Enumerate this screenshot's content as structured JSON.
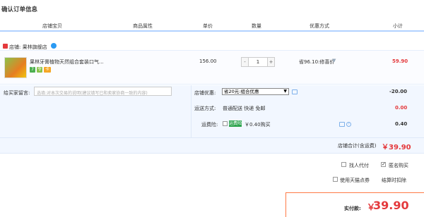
{
  "page_title": "确认订单信息",
  "table_headers": [
    "店铺宝贝",
    "商品属性",
    "单价",
    "数量",
    "优惠方式",
    "小计"
  ],
  "shop": {
    "label": "店铺: 果林旗舰店"
  },
  "item": {
    "title": "果林牙膏植物天然组合套装口气...",
    "badges": [
      "7",
      "令",
      "卡"
    ],
    "unit_price": "156.00",
    "quantity": "1",
    "minus": "-",
    "plus": "+",
    "promo": "省96.10:修喜价",
    "subtotal": "59.90"
  },
  "message": {
    "label": "给买家留言:",
    "placeholder": "选填:对本次交易的说明(建议填写已和卖家协商一致的内容)"
  },
  "coupon": {
    "label": "店铺优惠:",
    "selected": "省20元:组合优惠",
    "amount": "-20.00"
  },
  "shipping": {
    "label": "运送方式:",
    "value": "普通配送 快递 免邮",
    "amount": "0.00"
  },
  "insurance": {
    "label": "运费险:",
    "tag": "运费险",
    "text": "￥0.40购买",
    "amount": "0.40"
  },
  "shop_total": {
    "label": "店铺合计(含运费)",
    "amount": "￥39.90"
  },
  "options": {
    "proxy": "找人代付",
    "anonymous": "匿名购买",
    "tmall_points": "使用天猫点券",
    "settle": "结算时扣除"
  },
  "payment": {
    "label": "实付款:",
    "yen": "￥",
    "amount": "39.90"
  },
  "colors": {
    "accent": "#e4393c",
    "header_border": "#b2d1ff",
    "panel_bg": "#f2f7ff"
  }
}
